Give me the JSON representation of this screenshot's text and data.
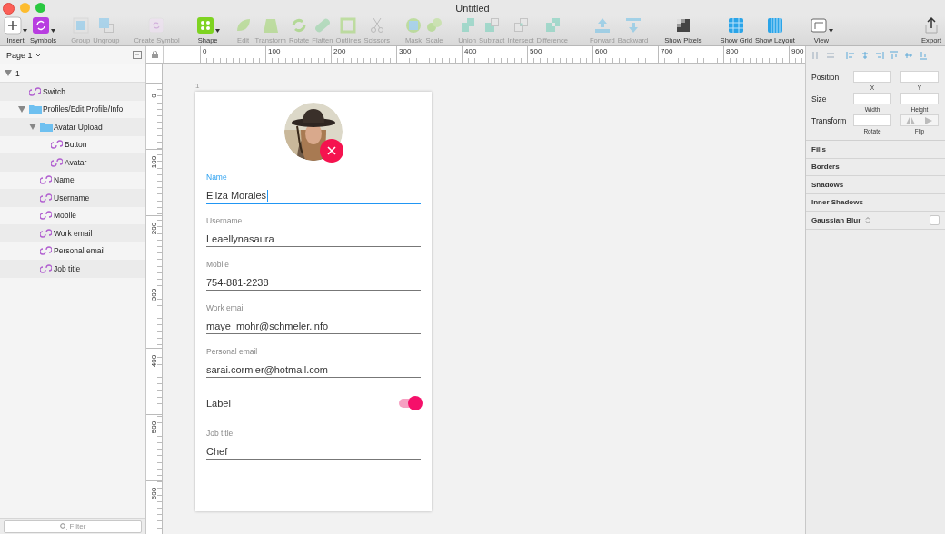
{
  "window": {
    "title": "Untitled"
  },
  "toolbar": {
    "groups": [
      [
        {
          "label": "Insert",
          "kind": "insert",
          "disabled": false,
          "dropdown": true
        },
        {
          "label": "Symbols",
          "kind": "symbols",
          "disabled": false,
          "dropdown": true
        }
      ],
      [
        {
          "label": "Group",
          "kind": "group",
          "disabled": true,
          "dropdown": false
        },
        {
          "label": "Ungroup",
          "kind": "ungroup",
          "disabled": true,
          "dropdown": false
        }
      ],
      [
        {
          "label": "Create Symbol",
          "kind": "createsymbol",
          "disabled": true,
          "dropdown": false
        }
      ],
      [
        {
          "label": "Shape",
          "kind": "shape",
          "disabled": false,
          "dropdown": true
        }
      ],
      [
        {
          "label": "Edit",
          "kind": "edit",
          "disabled": true,
          "dropdown": false
        },
        {
          "label": "Transform",
          "kind": "transform",
          "disabled": true,
          "dropdown": false
        },
        {
          "label": "Rotate",
          "kind": "rotate",
          "disabled": true,
          "dropdown": false
        },
        {
          "label": "Flatten",
          "kind": "flatten",
          "disabled": true,
          "dropdown": false
        },
        {
          "label": "Outlines",
          "kind": "outlines",
          "disabled": true,
          "dropdown": false
        },
        {
          "label": "Scissors",
          "kind": "scissors",
          "disabled": true,
          "dropdown": false
        }
      ],
      [
        {
          "label": "Mask",
          "kind": "mask",
          "disabled": true,
          "dropdown": false
        },
        {
          "label": "Scale",
          "kind": "scale",
          "disabled": true,
          "dropdown": false
        }
      ],
      [
        {
          "label": "Union",
          "kind": "union",
          "disabled": true,
          "dropdown": false
        },
        {
          "label": "Subtract",
          "kind": "subtract",
          "disabled": true,
          "dropdown": false
        },
        {
          "label": "Intersect",
          "kind": "intersect",
          "disabled": true,
          "dropdown": false
        },
        {
          "label": "Difference",
          "kind": "difference",
          "disabled": true,
          "dropdown": false
        }
      ],
      [
        {
          "label": "Forward",
          "kind": "forward",
          "disabled": true,
          "dropdown": false
        },
        {
          "label": "Backward",
          "kind": "backward",
          "disabled": true,
          "dropdown": false
        }
      ],
      [
        {
          "label": "Show Pixels",
          "kind": "pixels",
          "disabled": false,
          "dropdown": false
        }
      ],
      [
        {
          "label": "Show Grid",
          "kind": "grid",
          "disabled": false,
          "dropdown": false
        },
        {
          "label": "Show Layout",
          "kind": "layout",
          "disabled": false,
          "dropdown": false
        }
      ],
      [
        {
          "label": "View",
          "kind": "view",
          "disabled": false,
          "dropdown": true
        }
      ],
      [
        {
          "label": "Export",
          "kind": "export",
          "disabled": false,
          "dropdown": false
        }
      ]
    ]
  },
  "layers": {
    "page": "Page 1",
    "filter_placeholder": "Filter",
    "tree": [
      {
        "name": "1",
        "kind": "artboard",
        "expanded": true,
        "children": [
          {
            "name": "Switch",
            "kind": "symbol"
          },
          {
            "name": "Profiles/Edit Profile/Info",
            "kind": "folder",
            "expanded": true,
            "children": [
              {
                "name": "Avatar Upload",
                "kind": "folder",
                "expanded": true,
                "children": [
                  {
                    "name": "Button",
                    "kind": "symbol"
                  },
                  {
                    "name": "Avatar",
                    "kind": "symbol"
                  }
                ]
              },
              {
                "name": "Name",
                "kind": "symbol"
              },
              {
                "name": "Username",
                "kind": "symbol"
              },
              {
                "name": "Mobile",
                "kind": "symbol"
              },
              {
                "name": "Work email",
                "kind": "symbol"
              },
              {
                "name": "Personal email",
                "kind": "symbol"
              },
              {
                "name": "Job title",
                "kind": "symbol"
              }
            ]
          }
        ]
      }
    ]
  },
  "rulers": {
    "horizontal": [
      "0",
      "100",
      "200",
      "300",
      "400",
      "500",
      "600",
      "700",
      "800",
      "900"
    ],
    "vertical": [
      "0",
      "100",
      "200",
      "300",
      "400",
      "500",
      "600"
    ]
  },
  "artboard": {
    "label": "1",
    "fields": [
      {
        "kind": "text",
        "label": "Name",
        "value": "Eliza Morales",
        "focused": true
      },
      {
        "kind": "text",
        "label": "Username",
        "value": "Leaellynasaura",
        "focused": false
      },
      {
        "kind": "text",
        "label": "Mobile",
        "value": "754-881-2238",
        "focused": false
      },
      {
        "kind": "text",
        "label": "Work email",
        "value": "maye_mohr@schmeler.info",
        "focused": false
      },
      {
        "kind": "text",
        "label": "Personal email",
        "value": "sarai.cormier@hotmail.com",
        "focused": false
      },
      {
        "kind": "switch",
        "label": "Label",
        "on": true
      },
      {
        "kind": "text",
        "label": "Job title",
        "value": "Chef",
        "focused": false
      }
    ]
  },
  "inspector": {
    "rows": [
      {
        "label": "Position",
        "controls": [
          {
            "kind": "input",
            "caption": "X"
          },
          {
            "kind": "input",
            "caption": "Y"
          }
        ]
      },
      {
        "label": "Size",
        "controls": [
          {
            "kind": "input",
            "caption": "Width"
          },
          {
            "kind": "input",
            "caption": "Height"
          }
        ]
      },
      {
        "label": "Transform",
        "controls": [
          {
            "kind": "input",
            "caption": "Rotate"
          },
          {
            "kind": "flip",
            "caption": "Flip"
          }
        ]
      }
    ],
    "sections": [
      {
        "title": "Fills",
        "kind": "plain"
      },
      {
        "title": "Borders",
        "kind": "plain"
      },
      {
        "title": "Shadows",
        "kind": "plain"
      },
      {
        "title": "Inner Shadows",
        "kind": "plain"
      },
      {
        "title": "Gaussian Blur",
        "kind": "toggle",
        "checked": false
      }
    ]
  }
}
